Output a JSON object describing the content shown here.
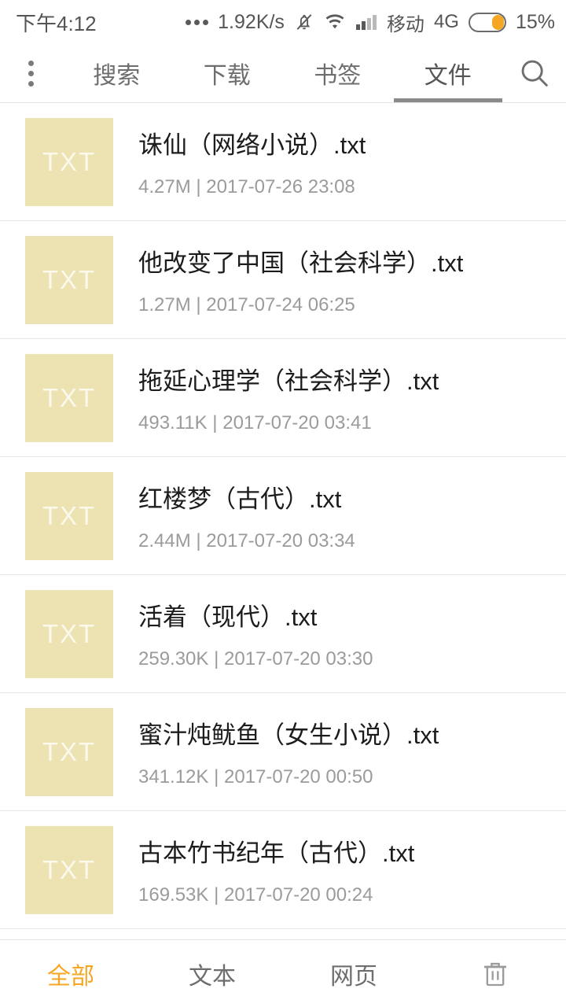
{
  "status_bar": {
    "clock": "下午4:12",
    "overflow_dots_icon": "three-dots-icon",
    "net_speed": "1.92K/s",
    "mute_icon": "bell-muted-icon",
    "wifi_icon": "wifi-icon",
    "signal_icon": "cellular-signal-icon",
    "carrier": "移动",
    "network_gen": "4G",
    "battery_icon": "battery-icon",
    "battery_pct": "15%",
    "battery_fill_color": "#f5a623",
    "text_color": "#555555"
  },
  "top_bar": {
    "menu_icon": "overflow-menu-icon",
    "search_icon": "search-icon",
    "tabs": [
      {
        "label": "搜索",
        "active": false
      },
      {
        "label": "下载",
        "active": false
      },
      {
        "label": "书签",
        "active": false
      },
      {
        "label": "文件",
        "active": true
      }
    ],
    "active_indicator_color": "#8a8a8a"
  },
  "file_list": {
    "thumb_label": "TXT",
    "thumb_color": "#ece2b2",
    "separator": " | ",
    "items": [
      {
        "name": "诛仙（网络小说）.txt",
        "size": "4.27M",
        "date": "2017-07-26 23:08"
      },
      {
        "name": "他改变了中国（社会科学）.txt",
        "size": "1.27M",
        "date": "2017-07-24 06:25"
      },
      {
        "name": "拖延心理学（社会科学）.txt",
        "size": "493.11K",
        "date": "2017-07-20 03:41"
      },
      {
        "name": "红楼梦（古代）.txt",
        "size": "2.44M",
        "date": "2017-07-20 03:34"
      },
      {
        "name": "活着（现代）.txt",
        "size": "259.30K",
        "date": "2017-07-20 03:30"
      },
      {
        "name": "蜜汁炖鱿鱼（女生小说）.txt",
        "size": "341.12K",
        "date": "2017-07-20 00:50"
      },
      {
        "name": "古本竹书纪年（古代）.txt",
        "size": "169.53K",
        "date": "2017-07-20 00:24"
      }
    ]
  },
  "bottom_nav": {
    "active_color": "#f5a623",
    "items": [
      {
        "label": "全部",
        "active": true
      },
      {
        "label": "文本",
        "active": false
      },
      {
        "label": "网页",
        "active": false
      }
    ],
    "trash_icon": "trash-icon"
  }
}
